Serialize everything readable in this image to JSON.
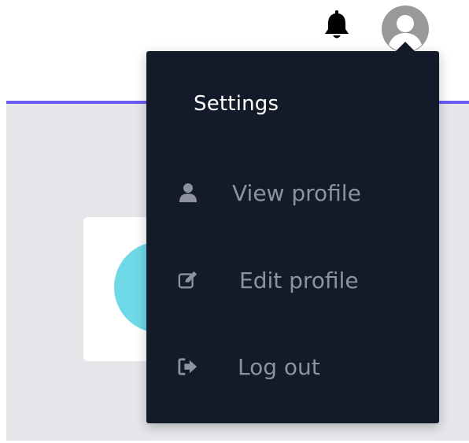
{
  "header": {
    "notifications_icon": "bell-icon",
    "user_icon": "user-avatar-icon"
  },
  "dropdown": {
    "title": "Settings",
    "items": [
      {
        "label": "View profile",
        "icon": "user-icon"
      },
      {
        "label": "Edit profile",
        "icon": "edit-icon"
      },
      {
        "label": "Log out",
        "icon": "logout-icon"
      }
    ]
  },
  "colors": {
    "accent": "#6b5cf5",
    "menu_bg": "#131a29",
    "menu_text": "#8e929c",
    "card_avatar": "#6fd9e8"
  }
}
